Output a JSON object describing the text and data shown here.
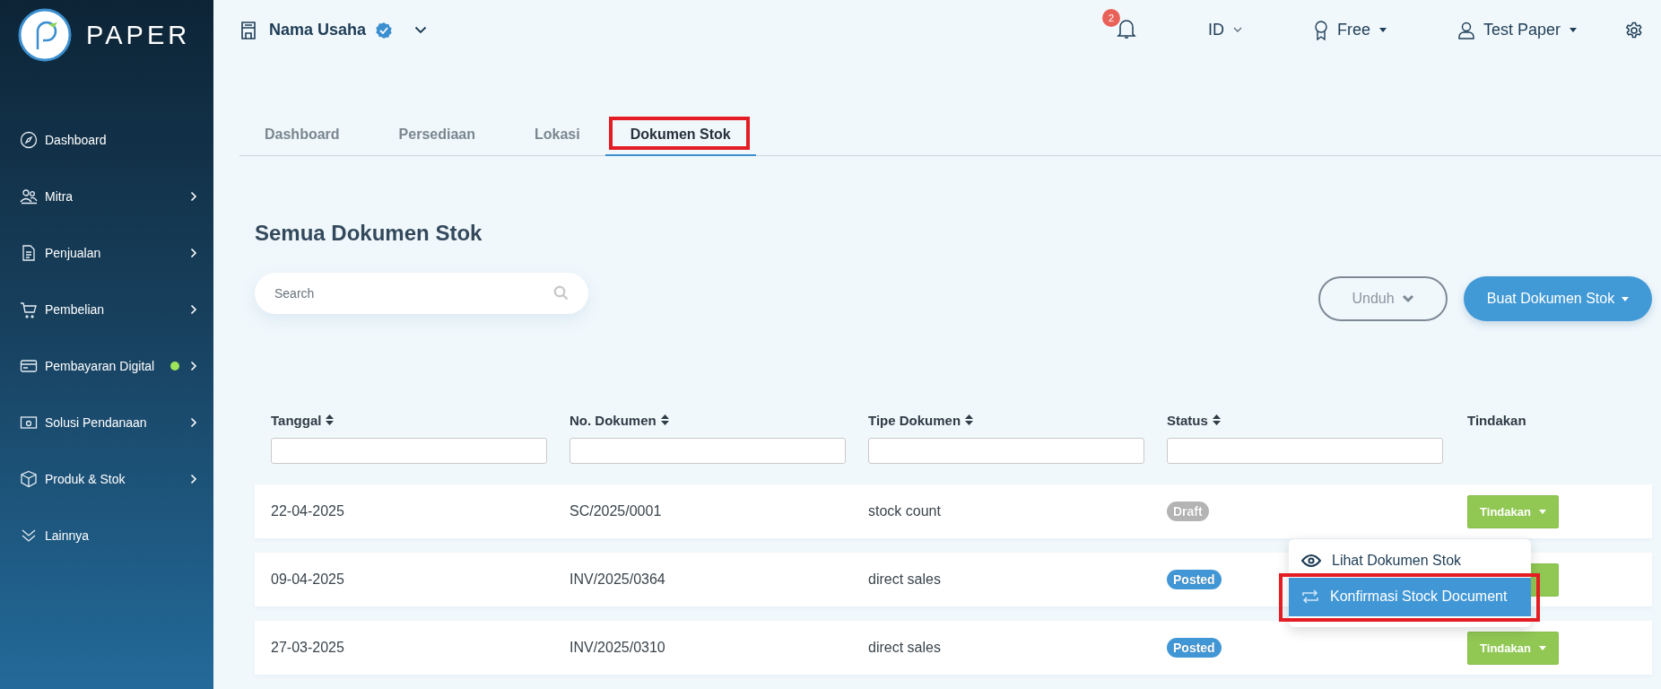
{
  "brand": {
    "name": "PAPER"
  },
  "sidebar": {
    "items": [
      {
        "label": "Dashboard",
        "expandable": false,
        "new": false
      },
      {
        "label": "Mitra",
        "expandable": true,
        "new": false
      },
      {
        "label": "Penjualan",
        "expandable": true,
        "new": false
      },
      {
        "label": "Pembelian",
        "expandable": true,
        "new": false
      },
      {
        "label": "Pembayaran Digital",
        "expandable": true,
        "new": true
      },
      {
        "label": "Solusi Pendanaan",
        "expandable": true,
        "new": false
      },
      {
        "label": "Produk & Stok",
        "expandable": true,
        "new": false
      },
      {
        "label": "Lainnya",
        "expandable": false,
        "new": false
      }
    ]
  },
  "topbar": {
    "business": "Nama Usaha",
    "verified": true,
    "notifications": "2",
    "language": "ID",
    "plan": "Free",
    "user": "Test Paper"
  },
  "tabs": [
    {
      "label": "Dashboard",
      "selected": false,
      "highlighted": false
    },
    {
      "label": "Persediaan",
      "selected": false,
      "highlighted": false
    },
    {
      "label": "Lokasi",
      "selected": false,
      "highlighted": false
    },
    {
      "label": "Dokumen Stok",
      "selected": true,
      "highlighted": true
    }
  ],
  "heading": "Semua Dokumen Stok",
  "search": {
    "placeholder": "Search"
  },
  "buttons": {
    "download": "Unduh",
    "create": "Buat Dokumen Stok"
  },
  "table": {
    "columns": [
      {
        "label": "Tanggal",
        "sortable": true,
        "filter": true
      },
      {
        "label": "No. Dokumen",
        "sortable": true,
        "filter": true
      },
      {
        "label": "Tipe Dokumen",
        "sortable": true,
        "filter": true
      },
      {
        "label": "Status",
        "sortable": true,
        "filter": true
      },
      {
        "label": "Tindakan",
        "sortable": false,
        "filter": false
      }
    ],
    "rows": [
      {
        "date": "22-04-2025",
        "number": "SC/2025/0001",
        "type": "stock count",
        "status": {
          "label": "Draft",
          "kind": "draft"
        },
        "action": "Tindakan"
      },
      {
        "date": "09-04-2025",
        "number": "INV/2025/0364",
        "type": "direct sales",
        "status": {
          "label": "Posted",
          "kind": "posted"
        },
        "menu": [
          {
            "label": "Lihat Dokumen Stok",
            "selected": false,
            "highlighted": false
          },
          {
            "label": "Konfirmasi Stock Document",
            "selected": true,
            "highlighted": true
          }
        ]
      },
      {
        "date": "27-03-2025",
        "number": "INV/2025/0310",
        "type": "direct sales",
        "status": {
          "label": "Posted",
          "kind": "posted"
        },
        "action": "Tindakan"
      }
    ]
  }
}
